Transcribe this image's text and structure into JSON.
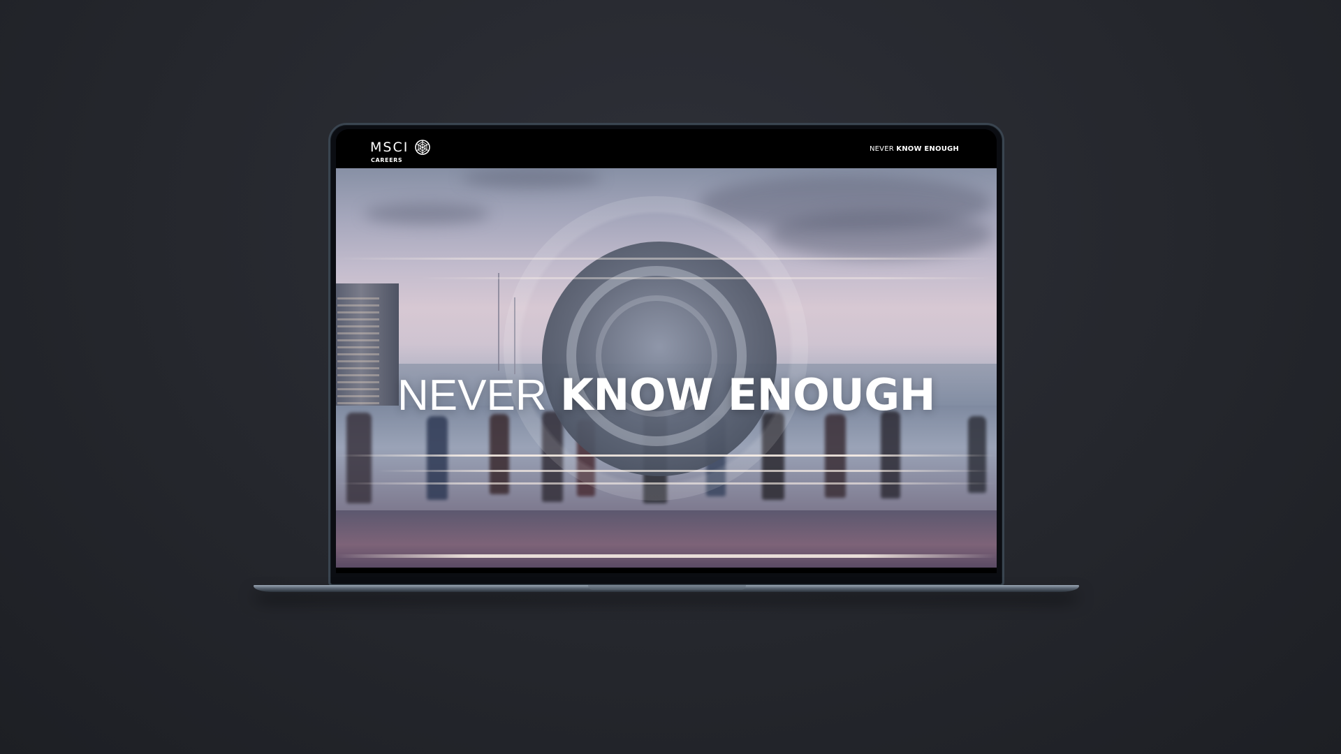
{
  "header": {
    "logo_text": "MSCI",
    "logo_subtext": "CAREERS",
    "tagline_light": "NEVER",
    "tagline_bold": "KNOW ENOUGH"
  },
  "hero": {
    "title_light": "NEVER",
    "title_bold": "KNOW ENOUGH"
  },
  "icons": {
    "logo_mark": "msci-globe-icon"
  },
  "colors": {
    "header_bg": "#000000",
    "background": "#25272d",
    "text": "#ffffff"
  }
}
